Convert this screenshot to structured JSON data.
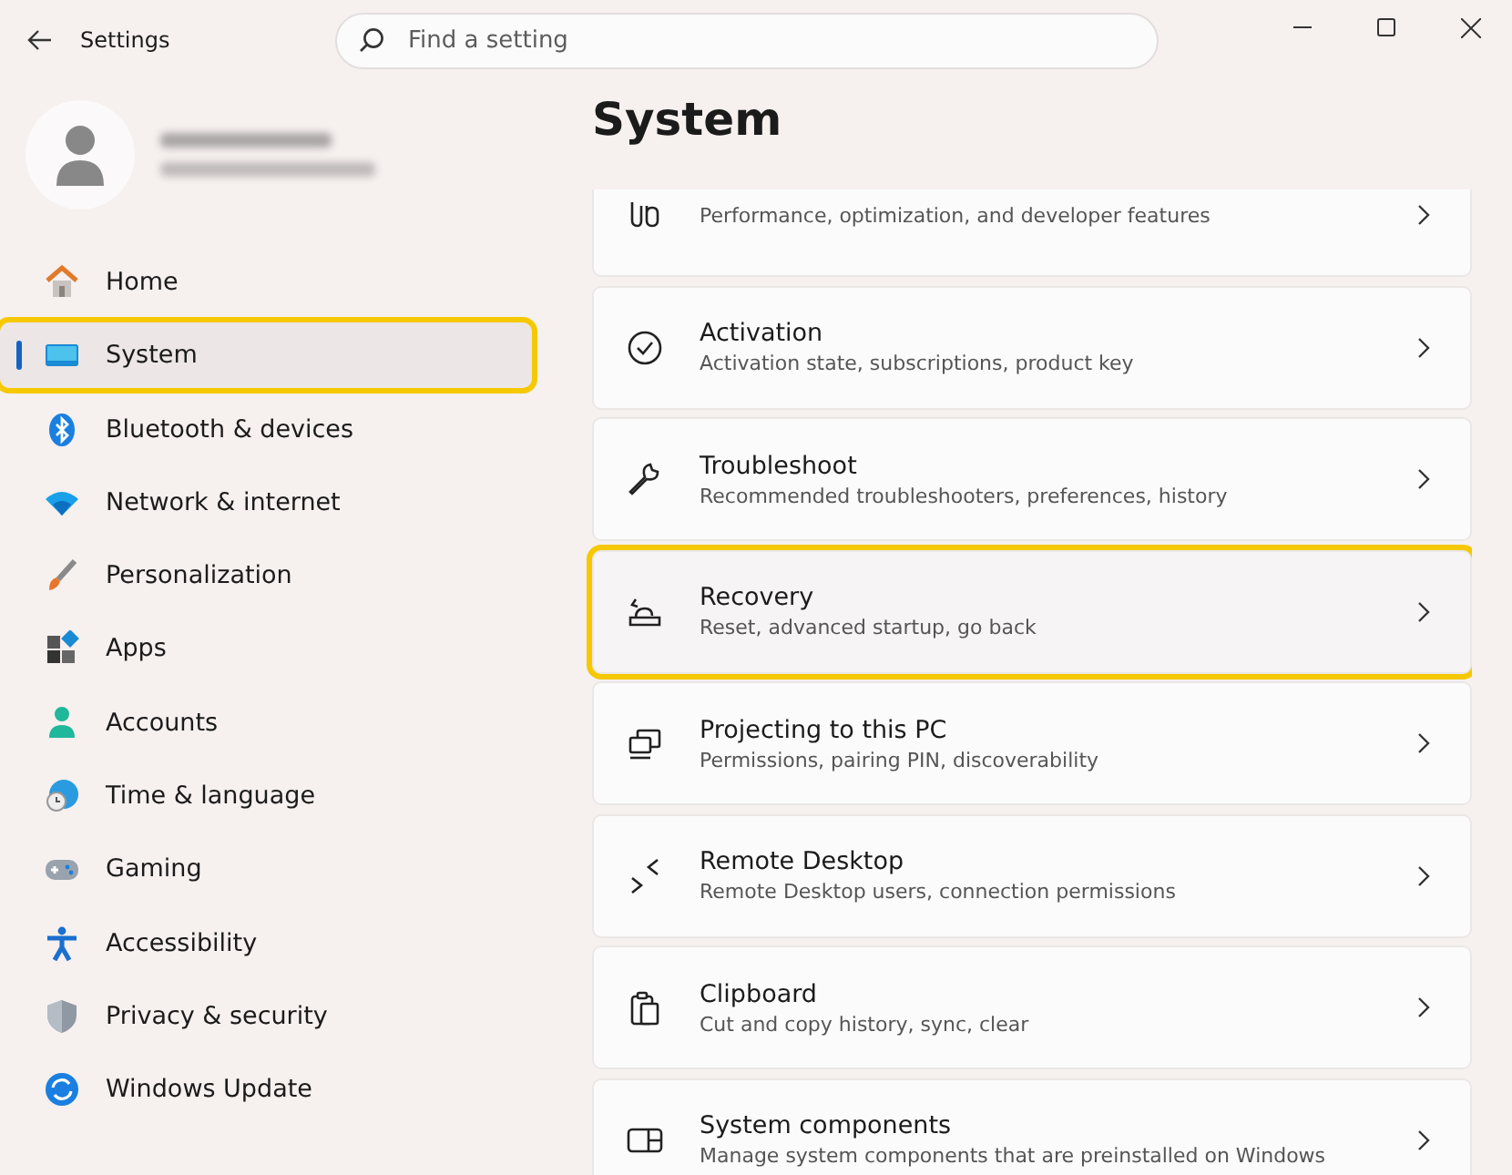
{
  "window": {
    "title": "Settings"
  },
  "search": {
    "placeholder": "Find a setting"
  },
  "sidebar": {
    "items": [
      {
        "label": "Home",
        "selected": false,
        "highlighted": false
      },
      {
        "label": "System",
        "selected": true,
        "highlighted": true
      },
      {
        "label": "Bluetooth & devices",
        "selected": false,
        "highlighted": false
      },
      {
        "label": "Network & internet",
        "selected": false,
        "highlighted": false
      },
      {
        "label": "Personalization",
        "selected": false,
        "highlighted": false
      },
      {
        "label": "Apps",
        "selected": false,
        "highlighted": false
      },
      {
        "label": "Accounts",
        "selected": false,
        "highlighted": false
      },
      {
        "label": "Time & language",
        "selected": false,
        "highlighted": false
      },
      {
        "label": "Gaming",
        "selected": false,
        "highlighted": false
      },
      {
        "label": "Accessibility",
        "selected": false,
        "highlighted": false
      },
      {
        "label": "Privacy & security",
        "selected": false,
        "highlighted": false
      },
      {
        "label": "Windows Update",
        "selected": false,
        "highlighted": false
      }
    ]
  },
  "page": {
    "title": "System",
    "cards": [
      {
        "subtitle": "Performance, optimization, and developer features",
        "highlighted": false
      },
      {
        "title": "Activation",
        "subtitle": "Activation state, subscriptions, product key",
        "highlighted": false
      },
      {
        "title": "Troubleshoot",
        "subtitle": "Recommended troubleshooters, preferences, history",
        "highlighted": false
      },
      {
        "title": "Recovery",
        "subtitle": "Reset, advanced startup, go back",
        "highlighted": true
      },
      {
        "title": "Projecting to this PC",
        "subtitle": "Permissions, pairing PIN, discoverability",
        "highlighted": false
      },
      {
        "title": "Remote Desktop",
        "subtitle": "Remote Desktop users, connection permissions",
        "highlighted": false
      },
      {
        "title": "Clipboard",
        "subtitle": "Cut and copy history, sync, clear",
        "highlighted": false
      },
      {
        "title": "System components",
        "subtitle": "Manage system components that are preinstalled on Windows",
        "highlighted": false
      }
    ]
  }
}
